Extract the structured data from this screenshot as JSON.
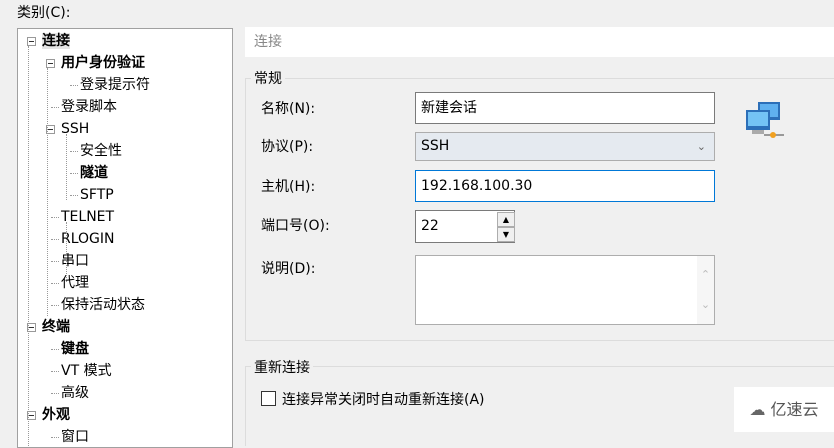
{
  "category_label": "类别(C):",
  "tree": [
    {
      "label": "连接",
      "level": 0,
      "bold": true,
      "expand": true
    },
    {
      "label": "用户身份验证",
      "level": 1,
      "bold": true,
      "expand": true
    },
    {
      "label": "登录提示符",
      "level": 2
    },
    {
      "label": "登录脚本",
      "level": 1
    },
    {
      "label": "SSH",
      "level": 1,
      "expand": true
    },
    {
      "label": "安全性",
      "level": 2
    },
    {
      "label": "隧道",
      "level": 2,
      "bold": true
    },
    {
      "label": "SFTP",
      "level": 2
    },
    {
      "label": "TELNET",
      "level": 1
    },
    {
      "label": "RLOGIN",
      "level": 1
    },
    {
      "label": "串口",
      "level": 1
    },
    {
      "label": "代理",
      "level": 1
    },
    {
      "label": "保持活动状态",
      "level": 1
    },
    {
      "label": "终端",
      "level": 0,
      "bold": true,
      "expand": true
    },
    {
      "label": "键盘",
      "level": 1,
      "bold": true
    },
    {
      "label": "VT 模式",
      "level": 1
    },
    {
      "label": "高级",
      "level": 1
    },
    {
      "label": "外观",
      "level": 0,
      "bold": true,
      "expand": true
    },
    {
      "label": "窗口",
      "level": 1
    }
  ],
  "header": "连接",
  "general": {
    "title": "常规",
    "name_label": "名称(N):",
    "name_value": "新建会话",
    "protocol_label": "协议(P):",
    "protocol_value": "SSH",
    "host_label": "主机(H):",
    "host_value": "192.168.100.30",
    "port_label": "端口号(O):",
    "port_value": "22",
    "desc_label": "说明(D):",
    "desc_value": ""
  },
  "reconnect": {
    "title": "重新连接",
    "checkbox_label": "连接异常关闭时自动重新连接(A)",
    "checked": false
  },
  "watermark": "亿速云"
}
